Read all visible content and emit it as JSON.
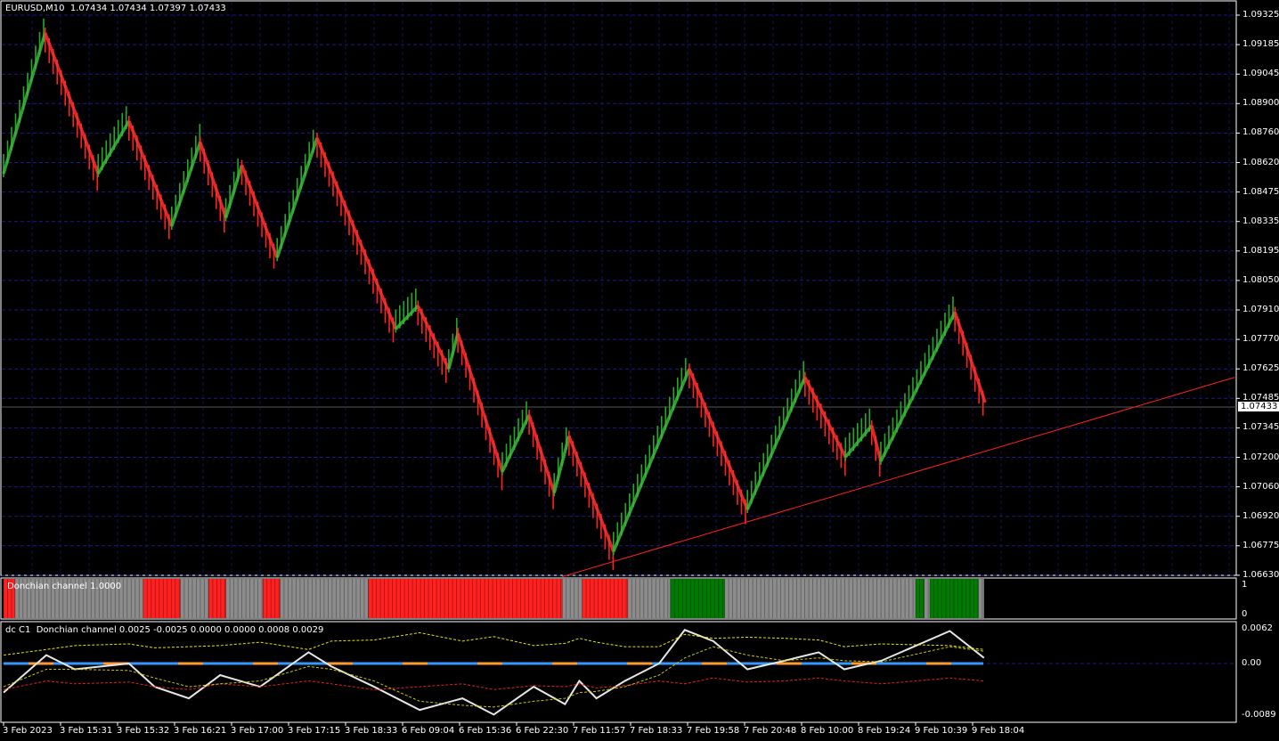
{
  "header": {
    "symbol_timeframe": "EURUSD,M10",
    "ohlc": "1.07434 1.07434 1.07397 1.07433"
  },
  "current_price": "1.07433",
  "colors": {
    "background": "#000000",
    "grid": "#1a1a8c",
    "up": "#22aa22",
    "down": "#ff2020",
    "trendline": "#ff2020",
    "neutral": "#8c8c8c",
    "green_block": "#007a00"
  },
  "time_axis": [
    "3 Feb 2023",
    "3 Feb 15:31",
    "3 Feb 15:32",
    "3 Feb 16:21",
    "3 Feb 17:00",
    "3 Feb 17:15",
    "3 Feb 18:33",
    "6 Feb 09:04",
    "6 Feb 15:36",
    "6 Feb 22:30",
    "7 Feb 11:57",
    "7 Feb 18:33",
    "7 Feb 19:58",
    "7 Feb 20:48",
    "8 Feb 10:00",
    "8 Feb 19:24",
    "9 Feb 10:39",
    "9 Feb 18:04"
  ],
  "chart_data": [
    {
      "type": "line",
      "name": "EURUSD,M10",
      "price_axis": [
        "1.09325",
        "1.09185",
        "1.09045",
        "1.08900",
        "1.08760",
        "1.08620",
        "1.08475",
        "1.08335",
        "1.08195",
        "1.08050",
        "1.07910",
        "1.07770",
        "1.07625",
        "1.07485",
        "1.07345",
        "1.07200",
        "1.07060",
        "1.06920",
        "1.06775",
        "1.06630"
      ],
      "ylim": [
        1.066,
        1.0935
      ],
      "grid": true,
      "pivots_time_index": [
        0,
        0.73,
        1.66,
        2.2,
        2.95,
        3.45,
        3.9,
        4.18,
        4.8,
        5.5,
        6.88,
        7.27,
        7.81,
        7.97,
        8.75,
        9.22,
        9.66,
        9.92,
        10.7,
        12.03,
        13.05,
        14.06,
        14.77,
        15.23,
        15.39,
        16.69,
        17.22
      ],
      "pivots_price": [
        1.0857,
        1.0924,
        1.0857,
        1.0882,
        1.0832,
        1.0872,
        1.0836,
        1.0861,
        1.0817,
        1.0874,
        1.0783,
        1.0794,
        1.0764,
        1.0781,
        1.0715,
        1.0742,
        1.0705,
        1.0732,
        1.0677,
        1.0764,
        1.0697,
        1.076,
        1.0722,
        1.0737,
        1.072,
        1.0791,
        1.0748
      ],
      "trendline": {
        "start": [
          9.8,
          1.0665
        ],
        "end": [
          21.6,
          1.076
        ]
      }
    },
    {
      "type": "bar",
      "name": "Donchian channel",
      "label": "Donchian channel 1.0000",
      "yaxis": [
        "1",
        "0"
      ],
      "segments": [
        {
          "from": 0,
          "to": 0.2,
          "state": "down"
        },
        {
          "from": 0.2,
          "to": 2.45,
          "state": "neutral"
        },
        {
          "from": 2.45,
          "to": 3.1,
          "state": "down"
        },
        {
          "from": 3.1,
          "to": 3.6,
          "state": "neutral"
        },
        {
          "from": 3.6,
          "to": 3.9,
          "state": "down"
        },
        {
          "from": 3.9,
          "to": 4.55,
          "state": "neutral"
        },
        {
          "from": 4.55,
          "to": 4.85,
          "state": "down"
        },
        {
          "from": 4.85,
          "to": 6.4,
          "state": "neutral"
        },
        {
          "from": 6.4,
          "to": 9.8,
          "state": "down"
        },
        {
          "from": 9.8,
          "to": 10.15,
          "state": "neutral"
        },
        {
          "from": 10.15,
          "to": 10.95,
          "state": "down"
        },
        {
          "from": 10.95,
          "to": 11.7,
          "state": "neutral"
        },
        {
          "from": 11.7,
          "to": 12.65,
          "state": "up"
        },
        {
          "from": 12.65,
          "to": 16.0,
          "state": "neutral"
        },
        {
          "from": 16.0,
          "to": 16.15,
          "state": "up"
        },
        {
          "from": 16.15,
          "to": 16.25,
          "state": "neutral"
        },
        {
          "from": 16.25,
          "to": 17.1,
          "state": "up"
        },
        {
          "from": 17.1,
          "to": 17.2,
          "state": "neutral"
        }
      ]
    },
    {
      "type": "line",
      "label_prefix": "dc C1",
      "label": "Donchian channel 0.0025 -0.0025 0.0000 0.0000 0.0008 0.0029",
      "yaxis": [
        "0.0062",
        "0.00",
        "-0.0089"
      ],
      "ylim": [
        -0.0089,
        0.0062
      ],
      "x": [
        0,
        0.75,
        1.25,
        2.2,
        2.65,
        3.25,
        3.8,
        4.5,
        5.35,
        5.75,
        6.5,
        7.3,
        8.05,
        8.6,
        9.3,
        9.85,
        10.1,
        10.4,
        10.9,
        11.5,
        11.95,
        12.45,
        13.05,
        13.7,
        14.3,
        14.75,
        15.4,
        16.6,
        17.2
      ],
      "series": [
        {
          "name": "oscillator",
          "color": "#e6e6e6",
          "values": [
            -0.005,
            0.0015,
            -0.001,
            0,
            -0.004,
            -0.006,
            -0.002,
            -0.004,
            0.002,
            -0.0005,
            -0.004,
            -0.008,
            -0.006,
            -0.0088,
            -0.004,
            -0.007,
            -0.003,
            -0.006,
            -0.003,
            0,
            0.006,
            0.004,
            -0.001,
            0.0005,
            0.002,
            -0.001,
            0.0005,
            0.0058,
            0.001
          ]
        },
        {
          "name": "upper",
          "color": "#e6e600",
          "values": [
            0.0015,
            0.0025,
            0.0032,
            0.0035,
            0.0028,
            0.003,
            0.0032,
            0.0038,
            0.0025,
            0.004,
            0.0042,
            0.0055,
            0.004,
            0.0048,
            0.0032,
            0.0036,
            0.0045,
            0.0038,
            0.003,
            0.003,
            0.0052,
            0.0045,
            0.0047,
            0.0045,
            0.0042,
            0.003,
            0.0035,
            0.0032,
            0.0025
          ]
        },
        {
          "name": "lower",
          "color": "#e62020",
          "values": [
            -0.0045,
            -0.003,
            -0.0035,
            -0.0032,
            -0.004,
            -0.0045,
            -0.0035,
            -0.004,
            -0.003,
            -0.0035,
            -0.0045,
            -0.004,
            -0.0035,
            -0.0045,
            -0.0038,
            -0.004,
            -0.0035,
            -0.0042,
            -0.0038,
            -0.003,
            -0.0035,
            -0.0025,
            -0.0032,
            -0.003,
            -0.0025,
            -0.003,
            -0.0035,
            -0.0025,
            -0.003
          ]
        },
        {
          "name": "signal",
          "color": "#c8c800",
          "values": [
            -0.004,
            -0.001,
            -0.001,
            -0.0012,
            -0.0025,
            -0.004,
            -0.0035,
            -0.003,
            -0.0005,
            -0.001,
            -0.003,
            -0.0065,
            -0.0072,
            -0.0075,
            -0.0065,
            -0.006,
            -0.005,
            -0.0048,
            -0.004,
            -0.002,
            0.001,
            0.003,
            0.0015,
            0.0005,
            0.001,
            0.0005,
            0.0003,
            0.003,
            0.0022
          ]
        }
      ]
    }
  ]
}
